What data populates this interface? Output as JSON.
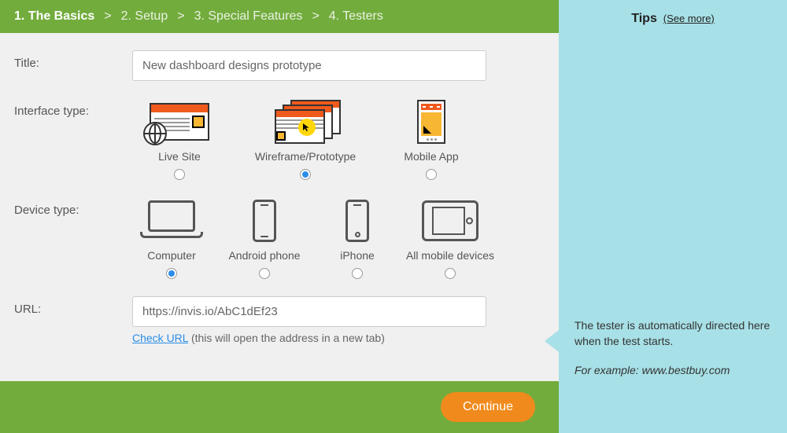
{
  "breadcrumb": {
    "items": [
      {
        "label": "1. The Basics",
        "active": true
      },
      {
        "label": "2. Setup",
        "active": false
      },
      {
        "label": "3. Special Features",
        "active": false
      },
      {
        "label": "4. Testers",
        "active": false
      }
    ]
  },
  "form": {
    "title_label": "Title:",
    "title_value": "New dashboard designs prototype",
    "interface_label": "Interface type:",
    "interface_options": [
      {
        "label": "Live Site",
        "selected": false
      },
      {
        "label": "Wireframe/Prototype",
        "selected": true
      },
      {
        "label": "Mobile App",
        "selected": false
      }
    ],
    "device_label": "Device type:",
    "device_options": [
      {
        "label": "Computer",
        "selected": true
      },
      {
        "label": "Android phone",
        "selected": false
      },
      {
        "label": "iPhone",
        "selected": false
      },
      {
        "label": "All mobile devices",
        "selected": false
      }
    ],
    "url_label": "URL:",
    "url_value": "https://invis.io/AbC1dEf23",
    "check_url_label": "Check URL",
    "check_url_hint": "(this will open the address in a new tab)"
  },
  "footer": {
    "continue_label": "Continue"
  },
  "tips": {
    "title": "Tips",
    "see_more": "(See more)",
    "body": "The tester is automatically directed here when the test starts.",
    "example": "For example: www.bestbuy.com"
  }
}
